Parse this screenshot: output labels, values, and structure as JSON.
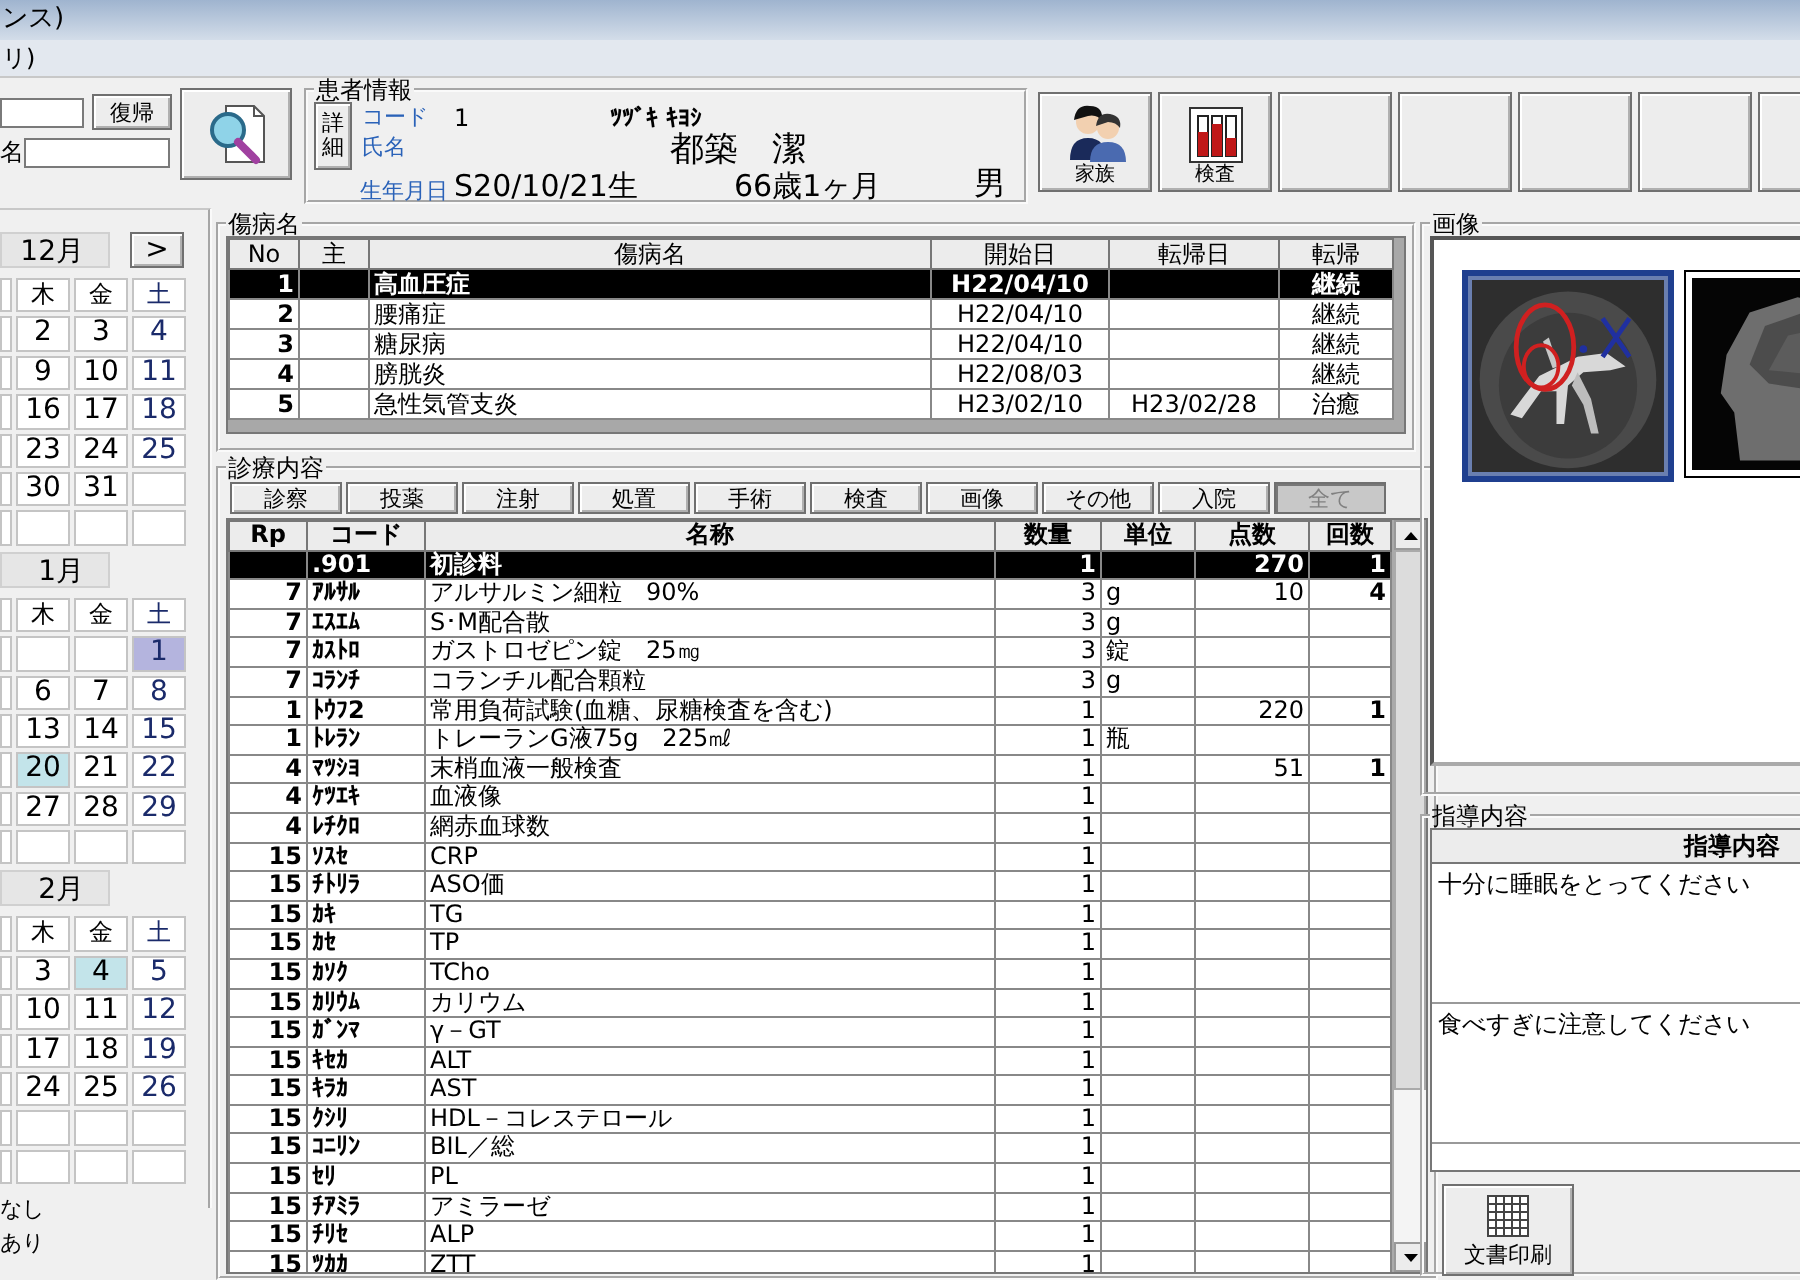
{
  "window": {
    "title": "ンス)"
  },
  "menu_bar": {
    "items": [
      "リ)"
    ]
  },
  "search_panel": {
    "restore_button": "復帰",
    "name_label": "名"
  },
  "patient_info": {
    "title": "患者情報",
    "detail_button": "詳細",
    "code_label": "コード",
    "code": "1",
    "kana": "ﾂﾂﾞｷ ｷﾖｼ",
    "name_label": "氏名",
    "name": "都築　潔",
    "birth_label": "生年月日",
    "birth": "S20/10/21生",
    "age": "66歳1ヶ月",
    "sex": "男"
  },
  "tool_buttons": [
    {
      "kind": "family",
      "label": "家族"
    },
    {
      "kind": "test",
      "label": "検査"
    },
    {
      "kind": "empty"
    },
    {
      "kind": "empty"
    },
    {
      "kind": "empty"
    },
    {
      "kind": "empty"
    },
    {
      "kind": "empty"
    }
  ],
  "calendar": {
    "next_button": ">",
    "months": [
      {
        "label": "12月",
        "weekdays": [
          "木",
          "金",
          "土"
        ],
        "weeks": [
          {
            "days": [
              "2",
              "3",
              "4"
            ]
          },
          {
            "days": [
              "9",
              "10",
              "11"
            ]
          },
          {
            "days": [
              "16",
              "17",
              "18"
            ]
          },
          {
            "days": [
              "23",
              "24",
              "25"
            ]
          },
          {
            "days": [
              "30",
              "31"
            ]
          }
        ]
      },
      {
        "label": "1月",
        "weekdays": [
          "木",
          "金",
          "土"
        ],
        "weeks": [
          {
            "kind": "partial_start",
            "days": [
              {
                "day": "1",
                "color": "#b4b4de"
              }
            ]
          },
          {
            "days": [
              "6",
              "7",
              "8"
            ]
          },
          {
            "days": [
              "13",
              "14",
              "15"
            ]
          },
          {
            "days": [
              {
                "day": "20",
                "color": "#c3e4ea"
              },
              "21",
              "22"
            ]
          },
          {
            "days": [
              "27",
              "28",
              "29"
            ]
          }
        ]
      },
      {
        "label": "2月",
        "weekdays": [
          "木",
          "金",
          "土"
        ],
        "weeks": [
          {
            "days": [
              "3",
              {
                "day": "4",
                "color": "#c3e4ea"
              },
              "5"
            ]
          },
          {
            "days": [
              "10",
              "11",
              "12"
            ]
          },
          {
            "days": [
              "17",
              "18",
              "19"
            ]
          },
          {
            "days": [
              "24",
              "25",
              "26"
            ]
          }
        ]
      }
    ],
    "legend": [
      "なし",
      "あり"
    ]
  },
  "diagnoses": {
    "title": "傷病名",
    "columns": [
      "No",
      "主",
      "傷病名",
      "開始日",
      "転帰日",
      "転帰"
    ],
    "rows": [
      {
        "no": "1",
        "name": "高血圧症",
        "start": "H22/04/10",
        "outcome": "継続",
        "selected": true
      },
      {
        "no": "2",
        "name": "腰痛症",
        "start": "H22/04/10",
        "outcome": "継続",
        "selected": false
      },
      {
        "no": "3",
        "name": "糖尿病",
        "start": "H22/04/10",
        "outcome": "継続",
        "selected": false
      },
      {
        "no": "4",
        "name": "膀胱炎",
        "start": "H22/08/03",
        "outcome": "継続",
        "selected": false
      },
      {
        "no": "5",
        "name": "急性気管支炎",
        "start": "H23/02/10",
        "end": "H23/02/28",
        "outcome": "治癒",
        "selected": false
      }
    ]
  },
  "treatment": {
    "title": "診療内容",
    "categories": [
      {
        "label": "診察",
        "selected": false
      },
      {
        "label": "投薬",
        "selected": false
      },
      {
        "label": "注射",
        "selected": false
      },
      {
        "label": "処置",
        "selected": false
      },
      {
        "label": "手術",
        "selected": false
      },
      {
        "label": "検査",
        "selected": false
      },
      {
        "label": "画像",
        "selected": false
      },
      {
        "label": "その他",
        "selected": false
      },
      {
        "label": "入院",
        "selected": false
      },
      {
        "label": "全て",
        "selected": true
      }
    ],
    "columns": [
      "Rp",
      "コード",
      "名称",
      "数量",
      "単位",
      "点数",
      "回数"
    ],
    "rows": [
      {
        "code": ".901",
        "name": "初診料",
        "qty": "1",
        "points": "270",
        "times": "1",
        "selected": true
      },
      {
        "rp": "7",
        "code": "ｱﾙｻﾙ",
        "name": "アルサルミン細粒　90%",
        "qty": "3",
        "unit": "g",
        "points": "10",
        "times": "4",
        "selected": false
      },
      {
        "rp": "7",
        "code": "ｴｽｴﾑ",
        "name": "S･M配合散",
        "qty": "3",
        "unit": "g",
        "selected": false
      },
      {
        "rp": "7",
        "code": "ｶｽﾄﾛ",
        "name": "ガストロゼピン錠　25㎎",
        "qty": "3",
        "unit": "錠",
        "selected": false
      },
      {
        "rp": "7",
        "code": "ｺﾗﾝﾁ",
        "name": "コランチル配合顆粒",
        "qty": "3",
        "unit": "g",
        "selected": false
      },
      {
        "rp": "1",
        "code": "ﾄｳﾌ2",
        "name": "常用負荷試験(血糖、尿糖検査を含む)",
        "qty": "1",
        "points": "220",
        "times": "1",
        "selected": false
      },
      {
        "rp": "1",
        "code": "ﾄﾚﾗﾝ",
        "name": "トレーランG液75g　225㎖",
        "qty": "1",
        "unit": "瓶",
        "selected": false
      },
      {
        "rp": "4",
        "code": "ﾏﾂｼﾖ",
        "name": "末梢血液一般検査",
        "qty": "1",
        "points": "51",
        "times": "1",
        "selected": false
      },
      {
        "rp": "4",
        "code": "ｹﾂｴｷ",
        "name": "血液像",
        "qty": "1",
        "selected": false
      },
      {
        "rp": "4",
        "code": "ﾚﾁｸﾛ",
        "name": "網赤血球数",
        "qty": "1",
        "selected": false
      },
      {
        "rp": "15",
        "code": "ｿｽｾ",
        "name": "CRP",
        "qty": "1",
        "selected": false
      },
      {
        "rp": "15",
        "code": "ﾁﾄﾘﾗ",
        "name": "ASO価",
        "qty": "1",
        "selected": false
      },
      {
        "rp": "15",
        "code": "ｶｷ",
        "name": "TG",
        "qty": "1",
        "selected": false
      },
      {
        "rp": "15",
        "code": "ｶｾ",
        "name": "TP",
        "qty": "1",
        "selected": false
      },
      {
        "rp": "15",
        "code": "ｶｿｸ",
        "name": "TCho",
        "qty": "1",
        "selected": false
      },
      {
        "rp": "15",
        "code": "ｶﾘｳﾑ",
        "name": "カリウム",
        "qty": "1",
        "selected": false
      },
      {
        "rp": "15",
        "code": "ｶﾞﾝﾏ",
        "name": "γ－GT",
        "qty": "1",
        "selected": false
      },
      {
        "rp": "15",
        "code": "ｷｾｶ",
        "name": "ALT",
        "qty": "1",
        "selected": false
      },
      {
        "rp": "15",
        "code": "ｷﾗｶ",
        "name": "AST",
        "qty": "1",
        "selected": false
      },
      {
        "rp": "15",
        "code": "ｸｼﾘ",
        "name": "HDL－コレステロール",
        "qty": "1",
        "selected": false
      },
      {
        "rp": "15",
        "code": "ｺﾆﾘﾝ",
        "name": "BIL／総",
        "qty": "1",
        "selected": false
      },
      {
        "rp": "15",
        "code": "ｾﾘ",
        "name": "PL",
        "qty": "1",
        "selected": false
      },
      {
        "rp": "15",
        "code": "ﾁｱﾐﾗ",
        "name": "アミラーゼ",
        "qty": "1",
        "selected": false
      },
      {
        "rp": "15",
        "code": "ﾁﾘｾ",
        "name": "ALP",
        "qty": "1",
        "selected": false
      },
      {
        "rp": "15",
        "code": "ﾂｶｶ",
        "name": "ZTT",
        "qty": "1",
        "selected": false
      }
    ]
  },
  "images": {
    "title": "画像",
    "thumbnails": [
      {
        "kind": "angiogram",
        "selected": true
      },
      {
        "kind": "mri",
        "selected": false
      }
    ]
  },
  "guidance": {
    "title": "指導内容",
    "column": "指導内容",
    "rows": [
      "十分に睡眠をとってください",
      "食べすぎに注意してください"
    ],
    "print_button": "文書印刷"
  }
}
